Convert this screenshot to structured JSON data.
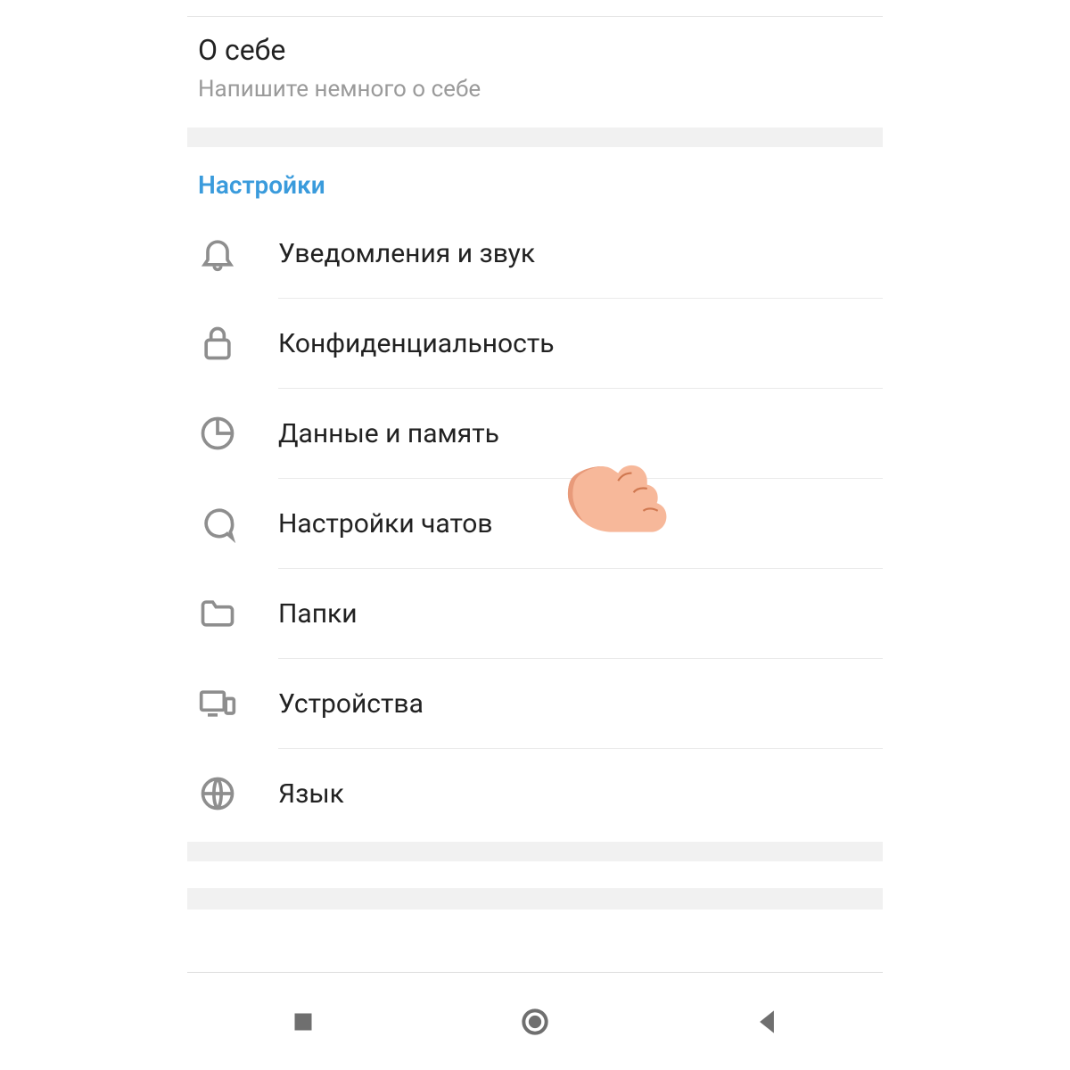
{
  "bio": {
    "title": "О себе",
    "subtitle": "Напишите немного о себе"
  },
  "settings": {
    "header": "Настройки",
    "items": [
      {
        "icon": "bell-icon",
        "label": "Уведомления и звук"
      },
      {
        "icon": "lock-icon",
        "label": "Конфиденциальность"
      },
      {
        "icon": "pie-icon",
        "label": "Данные и память"
      },
      {
        "icon": "chat-icon",
        "label": "Настройки чатов"
      },
      {
        "icon": "folder-icon",
        "label": "Папки"
      },
      {
        "icon": "devices-icon",
        "label": "Устройства"
      },
      {
        "icon": "globe-icon",
        "label": "Язык"
      }
    ]
  },
  "annotation": {
    "pointing_at_index": 2
  }
}
